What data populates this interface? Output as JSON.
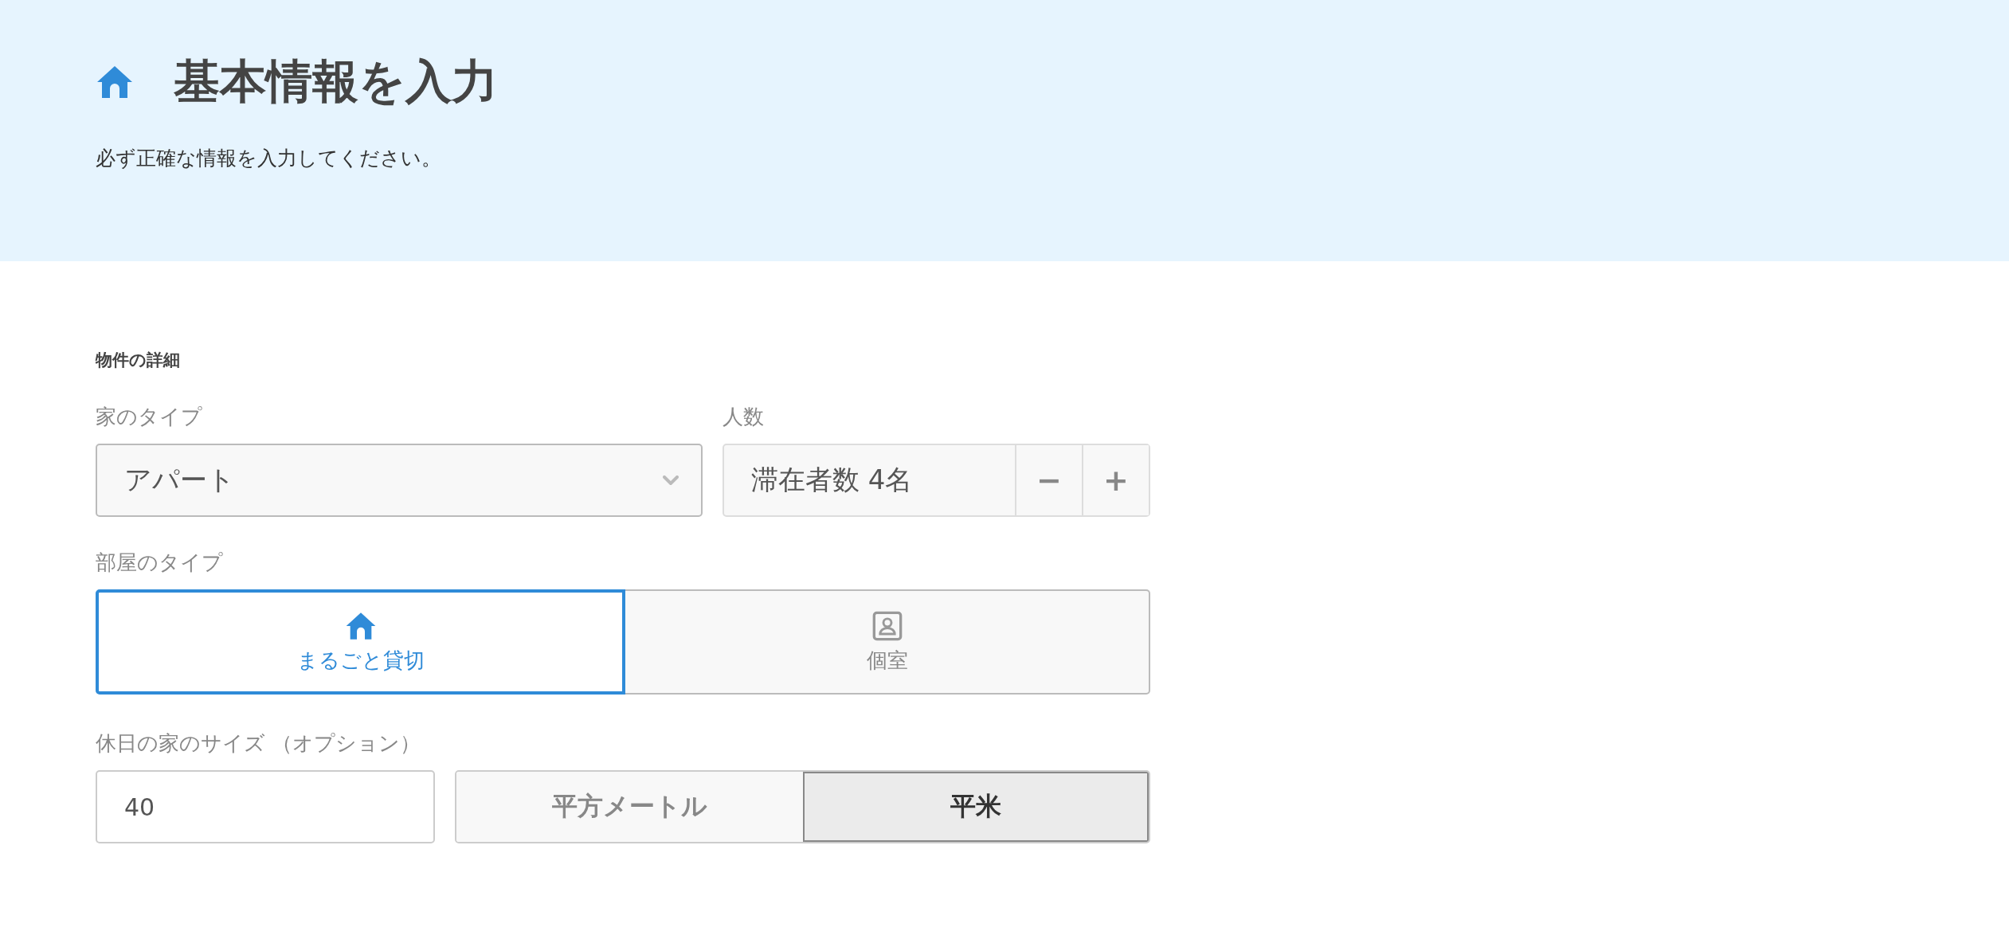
{
  "header": {
    "title": "基本情報を入力",
    "subtitle": "必ず正確な情報を入力してください。"
  },
  "section": {
    "heading": "物件の詳細"
  },
  "home_type": {
    "label": "家のタイプ",
    "value": "アパート"
  },
  "guests": {
    "label": "人数",
    "value": "滞在者数 4名",
    "decrement": "−",
    "increment": "+"
  },
  "room_type": {
    "label": "部屋のタイプ",
    "options": [
      {
        "kind": "house",
        "label": "まるごと貸切",
        "selected": true
      },
      {
        "kind": "person",
        "label": "個室",
        "selected": false
      }
    ]
  },
  "size": {
    "label": "休日の家のサイズ （オプション）",
    "value": "40",
    "units": [
      {
        "label": "平方メートル",
        "selected": false
      },
      {
        "label": "平米",
        "selected": true
      }
    ]
  }
}
